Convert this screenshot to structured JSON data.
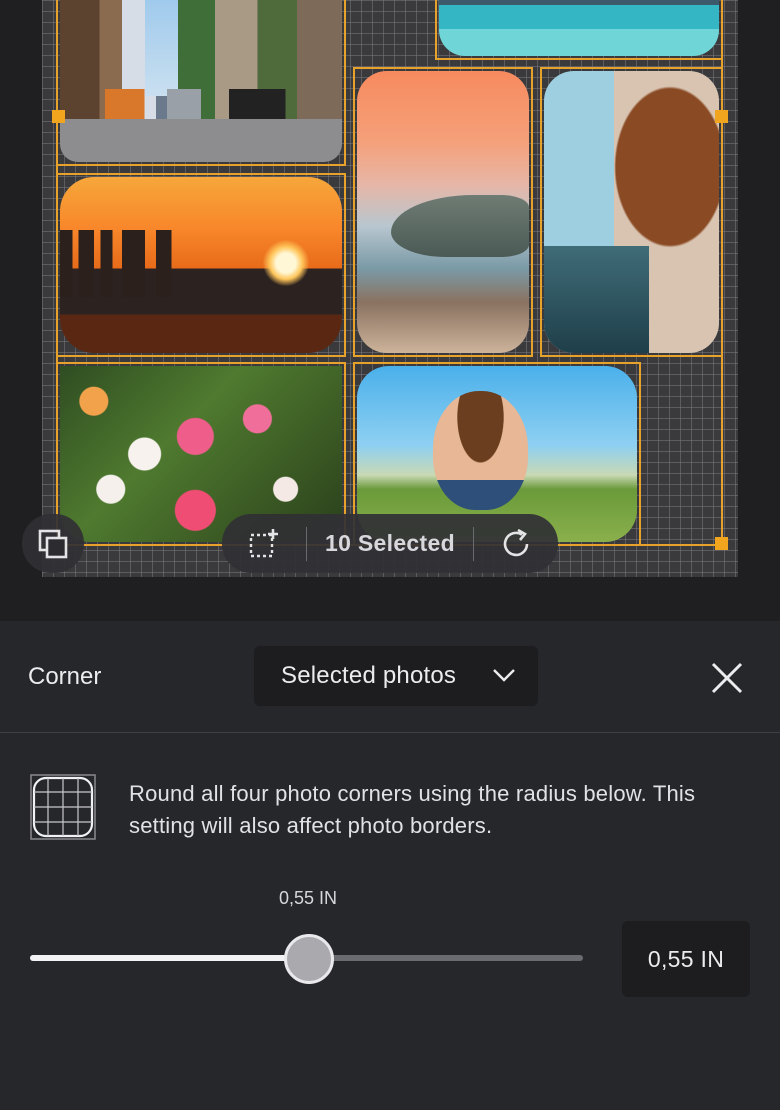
{
  "canvas": {
    "photos": [
      {
        "name": "photo-city-street",
        "style": "p-street"
      },
      {
        "name": "photo-turquoise-sea",
        "style": "p-sea"
      },
      {
        "name": "photo-city-sunset",
        "style": "p-sunset"
      },
      {
        "name": "photo-mountain-coast",
        "style": "p-coast"
      },
      {
        "name": "photo-woman-sunglasses",
        "style": "p-woman"
      },
      {
        "name": "photo-flowers",
        "style": "p-flowers"
      },
      {
        "name": "photo-boy-field",
        "style": "p-boy"
      }
    ],
    "accent_color": "#e6a22a"
  },
  "toolbar": {
    "selection_label": "10 Selected",
    "icons": {
      "layers": "layers-icon",
      "select": "add-selection-icon",
      "rotate": "rotate-icon"
    }
  },
  "panel": {
    "title": "Corner",
    "scope": {
      "selected": "Selected photos"
    },
    "description": "Round all four photo corners using the radius below. This setting will also affect photo borders.",
    "radius": {
      "bubble": "0,55 IN",
      "value": "0,55 IN",
      "slider_fraction": 0.505
    },
    "icons": {
      "corner": "corner-grid-icon",
      "close": "close-icon",
      "dropdown": "chevron-down-icon"
    }
  }
}
